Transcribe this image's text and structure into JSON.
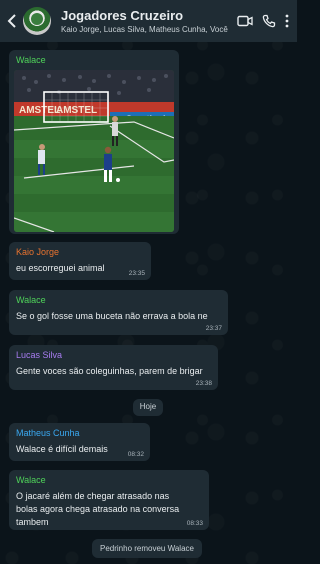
{
  "header": {
    "title": "Jogadores Cruzeiro",
    "members": "Kaio Jorge, Lucas Silva, Matheus Cunha, Você"
  },
  "icons": {
    "back": "back-arrow-icon",
    "video": "video-call-icon",
    "phone": "phone-call-icon",
    "menu": "more-options-icon"
  },
  "colors": {
    "walace": "#4fd25a",
    "kaio": "#e8732f",
    "lucas": "#a77cf0",
    "matheus": "#3aa8f0"
  },
  "messages": [
    {
      "sender": "Walace",
      "type": "image",
      "image_desc": "soccer-match-photo",
      "ad_text_1": "AMSTEL",
      "ad_text_2": "AMSTEL",
      "ad_text_3": "Sportingb"
    },
    {
      "sender": "Kaio Jorge",
      "text": "eu escorreguei animal",
      "time": "23:35"
    },
    {
      "sender": "Walace",
      "text": "Se o gol fosse uma buceta não errava a bola ne",
      "time": "23:37"
    },
    {
      "sender": "Lucas Silva",
      "text": "Gente voces são coleguinhas, parem de brigar",
      "time": "23:38"
    },
    {
      "sender": "Matheus Cunha",
      "text": "Walace é difícil demais",
      "time": "08:32"
    },
    {
      "sender": "Walace",
      "text": "O jacaré além de chegar atrasado nas bolas agora chega atrasado na conversa tambem",
      "time": "08:33"
    }
  ],
  "system": {
    "date_separator": "Hoje",
    "removed_notice": "Pedrinho removeu Walace"
  }
}
